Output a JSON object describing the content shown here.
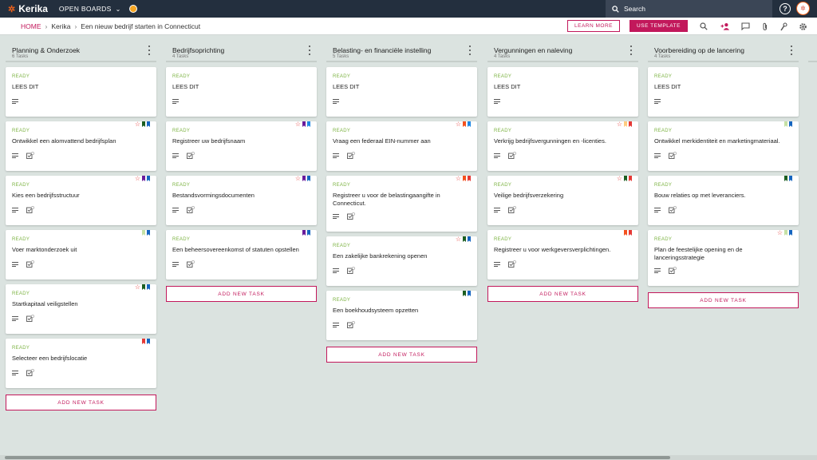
{
  "app": {
    "logo_text": "Kerika"
  },
  "topbar": {
    "open_boards_label": "OPEN BOARDS",
    "search_placeholder": "Search"
  },
  "breadcrumb": {
    "home": "HOME",
    "account": "Kerika",
    "board": "Een nieuw bedrijf starten in Connecticut"
  },
  "actions": {
    "learn_more": "LEARN MORE",
    "use_template": "USE TEMPLATE"
  },
  "add_task_label": "ADD NEW TASK",
  "colors": {
    "accent": "#c2185b",
    "status_ready": "#7cb342",
    "topbar": "#232f3e",
    "canvas": "#dbe3e0"
  },
  "columns": [
    {
      "title": "Planning & Onderzoek",
      "count": "6 Tasks",
      "cards": [
        {
          "status": "READY",
          "title": "LEES DIT",
          "star": false,
          "flags": []
        },
        {
          "status": "READY",
          "title": "Ontwikkel een alomvattend bedrijfsplan",
          "star": true,
          "flags": [
            "#1b5e20",
            "#1565c0"
          ]
        },
        {
          "status": "READY",
          "title": "Kies een bedrijfsstructuur",
          "star": true,
          "flags": [
            "#6a1b9a",
            "#1565c0"
          ]
        },
        {
          "status": "READY",
          "title": "Voer marktonderzoek uit",
          "star": false,
          "flags": [
            "#c5e1a5",
            "#1565c0"
          ]
        },
        {
          "status": "READY",
          "title": "Startkapitaal veiligstellen",
          "star": true,
          "flags": [
            "#1b5e20",
            "#1565c0"
          ]
        },
        {
          "status": "READY",
          "title": "Selecteer een bedrijfslocatie",
          "star": false,
          "flags": [
            "#e53935",
            "#1565c0"
          ]
        }
      ]
    },
    {
      "title": "Bedrijfsoprichting",
      "count": "4 Tasks",
      "cards": [
        {
          "status": "READY",
          "title": "LEES DIT",
          "star": false,
          "flags": []
        },
        {
          "status": "READY",
          "title": "Registreer uw bedrijfsnaam",
          "star": true,
          "flags": [
            "#6a1b9a",
            "#1e88e5"
          ]
        },
        {
          "status": "READY",
          "title": "Bestandsvormingsdocumenten",
          "star": true,
          "flags": [
            "#6a1b9a",
            "#1565c0"
          ]
        },
        {
          "status": "READY",
          "title": "Een beheersovereenkomst of statuten opstellen",
          "star": false,
          "flags": [
            "#6a1b9a",
            "#1565c0"
          ]
        }
      ]
    },
    {
      "title": "Belasting- en financiële instelling",
      "count": "5 Tasks",
      "cards": [
        {
          "status": "READY",
          "title": "LEES DIT",
          "star": false,
          "flags": []
        },
        {
          "status": "READY",
          "title": "Vraag een federaal EIN-nummer aan",
          "star": true,
          "flags": [
            "#f4511e",
            "#1e88e5"
          ]
        },
        {
          "status": "READY",
          "title": "Registreer u voor de belastingaangifte in Connecticut.",
          "star": true,
          "flags": [
            "#f4511e",
            "#e53935"
          ]
        },
        {
          "status": "READY",
          "title": "Een zakelijke bankrekening openen",
          "star": true,
          "flags": [
            "#1b5e20",
            "#1565c0"
          ]
        },
        {
          "status": "READY",
          "title": "Een boekhoudsysteem opzetten",
          "star": false,
          "flags": [
            "#1b5e20",
            "#1565c0"
          ]
        }
      ]
    },
    {
      "title": "Vergunningen en naleving",
      "count": "4 Tasks",
      "cards": [
        {
          "status": "READY",
          "title": "LEES DIT",
          "star": false,
          "flags": []
        },
        {
          "status": "READY",
          "title": "Verkrijg bedrijfsvergunningen en -licenties.",
          "star": true,
          "flags": [
            "#ffcc80",
            "#e53935"
          ]
        },
        {
          "status": "READY",
          "title": "Veilige bedrijfsverzekering",
          "star": true,
          "flags": [
            "#1b5e20",
            "#e53935"
          ]
        },
        {
          "status": "READY",
          "title": "Registreer u voor werkgeversverplichtingen.",
          "star": false,
          "flags": [
            "#f4511e",
            "#e53935"
          ]
        }
      ]
    },
    {
      "title": "Voorbereiding op de lancering",
      "count": "4 Tasks",
      "cards": [
        {
          "status": "READY",
          "title": "LEES DIT",
          "star": false,
          "flags": []
        },
        {
          "status": "READY",
          "title": "Ontwikkel merkidentiteit en marketingmateriaal.",
          "star": false,
          "flags": [
            "#c5e1a5",
            "#1565c0"
          ]
        },
        {
          "status": "READY",
          "title": "Bouw relaties op met leveranciers.",
          "star": false,
          "flags": [
            "#1b5e20",
            "#1565c0"
          ]
        },
        {
          "status": "READY",
          "title": "Plan de feestelijke opening en de lanceringsstrategie",
          "star": true,
          "flags": [
            "#c5e1a5",
            "#1565c0"
          ]
        }
      ]
    }
  ]
}
